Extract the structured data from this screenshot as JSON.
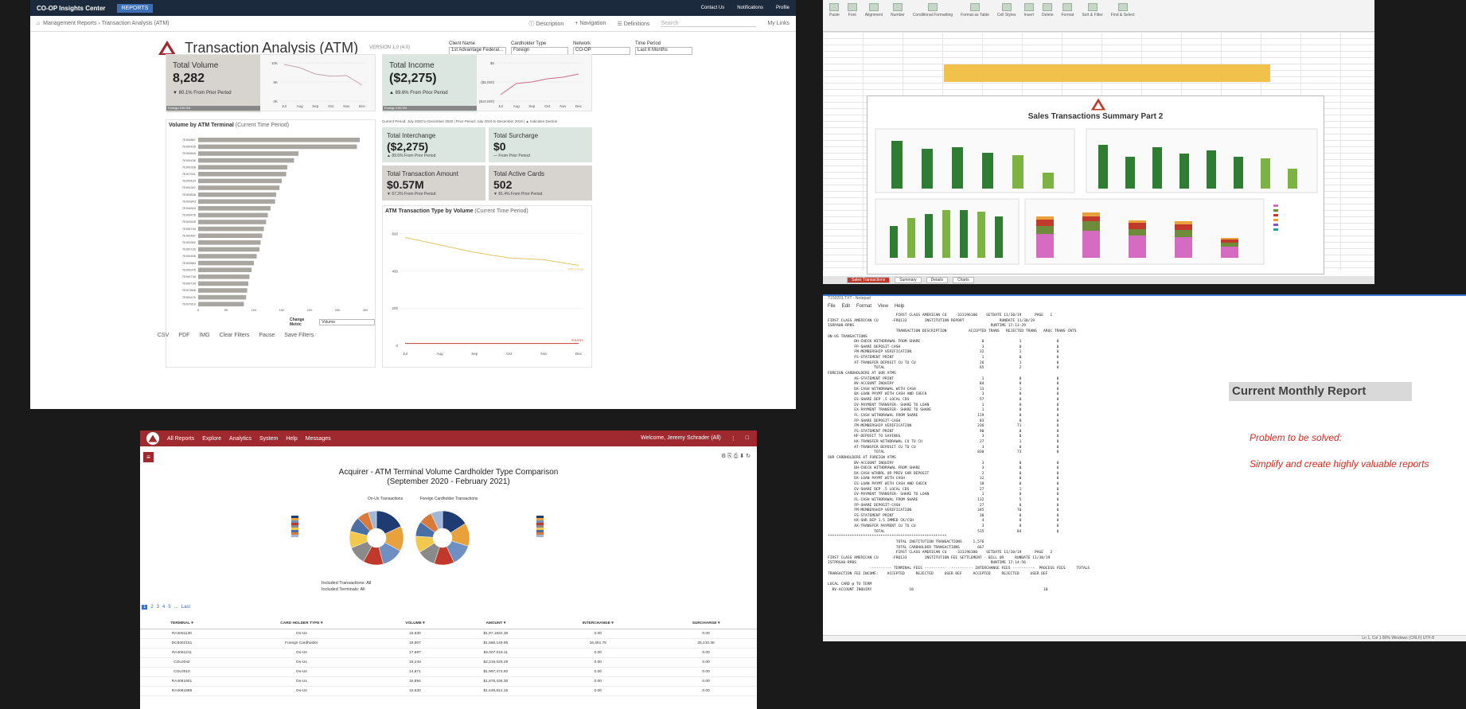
{
  "insights": {
    "app_title": "CO-OP Insights Center",
    "reports_menu": "REPORTS",
    "top_links": [
      "Contact Us",
      "Notifications",
      "Profile"
    ],
    "breadcrumb": [
      "Management Reports",
      "Transaction Analysis (ATM)"
    ],
    "toolbar": {
      "description": "Description",
      "navigation": "Navigation",
      "definitions": "Definitions",
      "search_placeholder": "Search",
      "my_links": "My Links"
    },
    "title": "Transaction Analysis (ATM)",
    "subtitle": "VERSION 1.0 (4.0)",
    "filters": [
      {
        "label": "Client Name",
        "value": "1st Advantage Federal..."
      },
      {
        "label": "Cardholder Type",
        "value": "Foreign"
      },
      {
        "label": "Network",
        "value": "CO-OP"
      },
      {
        "label": "Time Period",
        "value": "Last 6 Months"
      }
    ],
    "kpi_volume": {
      "label": "Total Volume",
      "value": "8,282",
      "change": "▼ 80.1% From Prior Period",
      "foot": "Foreign 100.0%"
    },
    "kpi_income": {
      "label": "Total Income",
      "value": "($2,275)",
      "change": "▲ 89.6% From Prior Period",
      "foot": "Foreign 100.0%"
    },
    "months": [
      "Jul",
      "Aug",
      "Sep",
      "Oct",
      "Nov",
      "Dec"
    ],
    "vol_chart_yticks": [
      "10K",
      "5K",
      "0K"
    ],
    "inc_chart_yticks": [
      "$0",
      "($5,000)",
      "($10,000)"
    ],
    "terminal_title": "Volume by ATM Terminal",
    "terminal_title_sub": "(Current Time Period)",
    "terminal_xticks": [
      "0",
      "50",
      "100",
      "150",
      "200",
      "250",
      "300"
    ],
    "change_metric_label": "Change Metric",
    "change_metric_value": "Volume",
    "period_legend": "Current Period: July 2020 to December 2020 | Prior Period: July 2019 to December 2019 | ▲ Indicates Decline",
    "tiles": [
      {
        "label": "Total Interchange",
        "value": "($2,275)",
        "sub": "▲ 89.6% From Prior Period"
      },
      {
        "label": "Total Surcharge",
        "value": "$0",
        "sub": "— From Prior Period"
      },
      {
        "label": "Total Transaction Amount",
        "value": "$0.57M",
        "sub": "▼ 67.3% From Prior Period"
      },
      {
        "label": "Total Active Cards",
        "value": "502",
        "sub": "▼ 81.4% From Prior Period"
      }
    ],
    "type_title": "ATM Transaction Type by Volume",
    "type_title_sub": "(Current Time Period)",
    "type_yticks": [
      "600",
      "400",
      "200",
      "0"
    ],
    "type_series": [
      "Withdrawal",
      "Inquiries"
    ],
    "footer": [
      "CSV",
      "PDF",
      "IMG",
      "Clear Filters",
      "Pause",
      "Save Filters"
    ]
  },
  "excel": {
    "ribbon": [
      "Paste",
      "Font",
      "Alignment",
      "Number",
      "Conditional Formatting",
      "Format as Table",
      "Cell Styles",
      "Insert",
      "Delete",
      "Format",
      "Sort & Filter",
      "Find & Select"
    ],
    "sheet_title": "Sales Transactions Summary Part 2",
    "tabs": [
      "Sales Transactions",
      "Summary",
      "Details",
      "Charts"
    ]
  },
  "notepad": {
    "title": "T150201.TXT - Notepad",
    "menu": [
      "File",
      "Edit",
      "Format",
      "View",
      "Help"
    ],
    "report_lines": [
      "                               FIRST CLASS AMERICAN CU    -331196100    SETDATE 11/30/19      PAGE   1",
      "FIRST CLASS AMERICAN CU      -FRQ133        INSTITUTION REPORT                RUNDATE 11/30/19",
      "ISRPA00-RPBS                                                              RUNTIME 17:13:29",
      "                               TRANSACTION DESCRIPTION          ACCEPTED TRANS   REJECTED TRANS   ARQC TRANS CNTS",
      "ON-US TRANSACTIONS",
      "            DH-CHECK WITHDRAWAL FROM SHARE                            0                1                0",
      "            FP-SHARE DEPOSIT-CASH                                     3                0                0",
      "            FM-MEMBERSHIP VERIFICATION                               32                1                0",
      "            FS-STATEMENT PRINT                                        1                0                0",
      "            AT-TRANSFER DEPOSIT CU TO CU                             26                1                0",
      "                     TOTAL                                           65                2                0",
      "FOREIGN CARDHOLDERS AT OUR ATMS",
      "            AS-STATEMENT PRINT                                        1                0                0",
      "            BV-ACCOUNT INQUIRY                                       84                0                0",
      "            DX-CASH WITHDRAWAL WITH CASH                             13                1                0",
      "            BX-LOAN PAYMT WITH CASH AND CHECK                         3                0                0",
      "            ES-SHARE DEP .5 LOCAL CDS                                57                0                0",
      "            EV-PAYMENT TRANSFER- SHARE TO LOAN                        1                0                0",
      "            EX-PAYMENT TRANSFER- SHARE TO SHARE                       1                0                0",
      "            FL-CASH WITHDRAWAL FROM SHARE                           119                0                0",
      "            FP-SHARE DEPOSIT-CASH                                    83                0                0",
      "            FM-MEMBERSHIP VERIFICATION                              236               71                0",
      "            FS-STATEMENT PRINT                                       90                0                0",
      "            HF-DEPOSIT TO SAVINGS                                     3                0                0",
      "            HX-TRANSFER WITHDRAWAL CU TO CU                          27                1                0",
      "            AT-TRANSFER DEPOSIT CU TO CU                              3                0                0",
      "                     TOTAL                                          830               73                0",
      "OUR CARDHOLDERS AT FOREIGN ATMS",
      "            BV-ACCOUNT INQUIRY                                        3                0                0",
      "            DH-CHECK WITHDRAWAL FROM SHARE                            3                0                0",
      "            DX-CASH WTHDRL OR PREV SHR DEPOSIT                        2                0                0",
      "            DX-LOAN PAYMT WITH CASH                                  12                0                0",
      "            ES-LOAN PAYMT WITH CASH AND CHECK                        10                0                0",
      "            EV-SHARE DEP .5 LOCAL CDS                                27                1                0",
      "            EV-PAYMENT TRANSFER- SHARE TO LOAN                        1                0                0",
      "            FL-CASH WITHDRAWAL FROM SHARE                           132                5                0",
      "            FP-SHARE DEPOSIT-CASH                                    27                0                0",
      "            FM-MEMBERSHIP VERIFICATION                              345               70                0",
      "            FS-STATEMENT PRINT                                       30                0                0",
      "            HX-SHR DEP 1.5 IMMED CK/CSH                               4                0                0",
      "            AX-TRANSFER PAYMENT CU TO CU                              3                0                0",
      "                     TOTAL                                          515               84                0",
      "******************************************************",
      "                               TOTAL INSTITUTION TRANSACTIONS     1,576",
      "                               TOTAL CARDHOLDER TRANSACTIONS        667",
      "                               FIRST CLASS AMERICAN CU    -331196100    SETDATE 11/30/19      PAGE   2",
      "FIRST CLASS AMERICAN CU      -FRQ133        INSTITUTION FEE SETTLEMENT - BILL OR     RUNDATE 11/30/19",
      "ISTPRSA0-RPBS                                                             RUNTIME 17:14:56",
      "                   ---------- TERMINAL FEES ----------  ---------- INTERCHANGE FEES ----------  PROCESS FEES     TOTALS",
      "TRANSACTION FEE INCOME:    ACCEPTED     REJECTED     USER DEF     ACCEPTED     REJECTED     USER DEF",
      "",
      "LOCAL CARD @ TO TERM",
      "  BV-ACCOUNT INQUIRY                 10                                                           10"
    ],
    "status": "Ln 1, Col 1      80%    Windows (CRLF)    UTF-8",
    "report_label": "Current Monthly Report",
    "problem_title": "Problem to be solved:",
    "problem_text": "Simplify and create highly valuable reports"
  },
  "web": {
    "nav": [
      "All Reports",
      "Explore",
      "Analytics",
      "System",
      "Help",
      "Messages"
    ],
    "welcome": "Welcome, Jeremy Schrader (All)",
    "title_line1": "Acquirer - ATM Terminal Volume Cardholder Type Comparison",
    "title_line2": "(September 2020 - February 2021)",
    "pie1_title": "On-Us Transactions",
    "pie2_title": "Foreign Cardholder Transactions",
    "included_transactions": "Included Transactions: All",
    "included_terminals": "Included Terminals: All",
    "pager": [
      "1",
      "2",
      "3",
      "4",
      "5",
      "...",
      "Last"
    ],
    "columns": [
      "TERMINAL ▾",
      "CARD HOLDER TYPE ▾",
      "VOLUME ▾",
      "AMOUNT ▾",
      "INTERCHANGE ▾",
      "SURCHARGE ▾"
    ],
    "rows": [
      [
        "RA4061130",
        "On-Us",
        "15,830",
        "$1,87,1832.36",
        "0.00",
        "0.00"
      ],
      [
        "DC8402151",
        "Foreign Cardholder",
        "18,907",
        "$1,566,149.95",
        "16,481.75",
        "26,210.38"
      ],
      [
        "RA4061211",
        "On-Us",
        "17,587",
        "$2,007,018.11",
        "0.00",
        "0.00"
      ],
      [
        "COL0042",
        "On-Us",
        "16,243",
        "$2,219,025.29",
        "0.00",
        "0.00"
      ],
      [
        "COL0010",
        "On-Us",
        "14,871",
        "$1,997,474.92",
        "0.00",
        "0.00"
      ],
      [
        "RA4061901",
        "On-Us",
        "15,894",
        "$1,876,436.30",
        "0.00",
        "0.00"
      ],
      [
        "RA4061889",
        "On-Us",
        "10,830",
        "$1,649,812.16",
        "0.00",
        "0.00"
      ]
    ]
  },
  "chart_data": [
    {
      "type": "line",
      "title": "Total Volume",
      "categories": [
        "Jul",
        "Aug",
        "Sep",
        "Oct",
        "Nov",
        "Dec"
      ],
      "values": [
        11500,
        10500,
        8500,
        7800,
        8000,
        5000
      ],
      "ylim": [
        0,
        12000
      ]
    },
    {
      "type": "line",
      "title": "Total Income",
      "categories": [
        "Jul",
        "Aug",
        "Sep",
        "Oct",
        "Nov",
        "Dec"
      ],
      "values": [
        -9000,
        -5500,
        -5000,
        -4000,
        -3500,
        -2500
      ],
      "ylim": [
        -11000,
        1000
      ]
    },
    {
      "type": "bar",
      "title": "Volume by ATM Terminal",
      "categories": [
        "7EI00887",
        "7EI00435",
        "7EI00899",
        "7EI00436",
        "7EI00398",
        "7EI07531",
        "7EI00424",
        "7EI00267",
        "7EI00838",
        "7EI00843",
        "7EI04813",
        "7EI00476",
        "7EI00528",
        "7EI06740",
        "7EI00487",
        "7EI00962",
        "7EI00739",
        "7EI00456",
        "7EI00884",
        "7EI00975",
        "7EI00738",
        "7EI00734",
        "7EI07806",
        "7EI00476",
        "7EI07810"
      ],
      "values": [
        290,
        285,
        180,
        172,
        160,
        158,
        150,
        146,
        140,
        138,
        130,
        125,
        122,
        118,
        115,
        112,
        110,
        105,
        100,
        96,
        92,
        90,
        88,
        86,
        82
      ],
      "xlim": [
        0,
        300
      ]
    },
    {
      "type": "line",
      "title": "ATM Transaction Type by Volume",
      "categories": [
        "Jul",
        "Aug",
        "Sep",
        "Oct",
        "Nov",
        "Dec"
      ],
      "series": [
        {
          "name": "Withdrawal",
          "values": [
            580,
            540,
            500,
            470,
            460,
            430
          ]
        },
        {
          "name": "Inquiries",
          "values": [
            10,
            10,
            10,
            10,
            10,
            10
          ]
        }
      ],
      "ylim": [
        0,
        650
      ]
    },
    {
      "type": "pie",
      "title": "On-Us Transactions",
      "values": [
        18,
        15,
        13,
        12,
        11,
        10,
        9,
        7,
        5
      ]
    },
    {
      "type": "pie",
      "title": "Foreign Cardholder Transactions",
      "values": [
        16,
        14,
        13,
        12,
        11,
        10,
        9,
        8,
        7
      ]
    }
  ],
  "colors": {
    "insights_topbar": "#1c2a3d",
    "web_nav": "#9e2a2f",
    "excel_bar_dark": "#2e7d32",
    "excel_bar_light": "#7cb342",
    "problem_text": "#d42a1e"
  }
}
